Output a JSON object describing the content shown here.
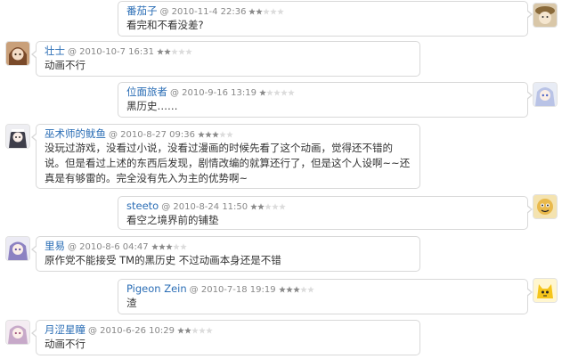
{
  "star_colors": {
    "filled": "#8a8a8a",
    "empty": "#dcdcdc"
  },
  "comments": [
    {
      "user": "番茄子",
      "date": "@ 2010-11-4 22:36",
      "rating": 2,
      "text": "看完和不看没差?",
      "avatar_icon": "avatar-cat-hat"
    },
    {
      "user": "壮士",
      "date": "@ 2010-10-7 16:31",
      "rating": 2,
      "text": "动画不行",
      "avatar_icon": "avatar-doll"
    },
    {
      "user": "位面旅者",
      "date": "@ 2010-9-16 13:19",
      "rating": 1,
      "text": "黑历史……",
      "avatar_icon": "avatar-anime-girl"
    },
    {
      "user": "巫术师的鱿鱼",
      "date": "@ 2010-8-27 09:36",
      "rating": 3,
      "text": "没玩过游戏，没看过小说，没看过漫画的时候先看了这个动画，觉得还不错的说。但是看过上述的东西后发现，剧情改编的就算还行了，但是这个人设啊~~还真是有够雷的。完全没有先入为主的优势啊~",
      "avatar_icon": "avatar-maid"
    },
    {
      "user": "steeto",
      "date": "@ 2010-8-24 11:50",
      "rating": 2,
      "text": "看空之境界前的铺垫",
      "avatar_icon": "avatar-cartoon"
    },
    {
      "user": "里易",
      "date": "@ 2010-8-6 04:47",
      "rating": 3,
      "text": "原作党不能接受 TM的黑历史 不过动画本身还是不错",
      "avatar_icon": "avatar-purple-hair"
    },
    {
      "user": "Pigeon Zein",
      "date": "@ 2010-7-18 19:19",
      "rating": 3,
      "text": "渣",
      "avatar_icon": "avatar-yellow-mascot"
    },
    {
      "user": "月涩星瞳",
      "date": "@ 2010-6-26 10:29",
      "rating": 2,
      "text": "动画不行",
      "avatar_icon": "avatar-pink-hair"
    }
  ]
}
